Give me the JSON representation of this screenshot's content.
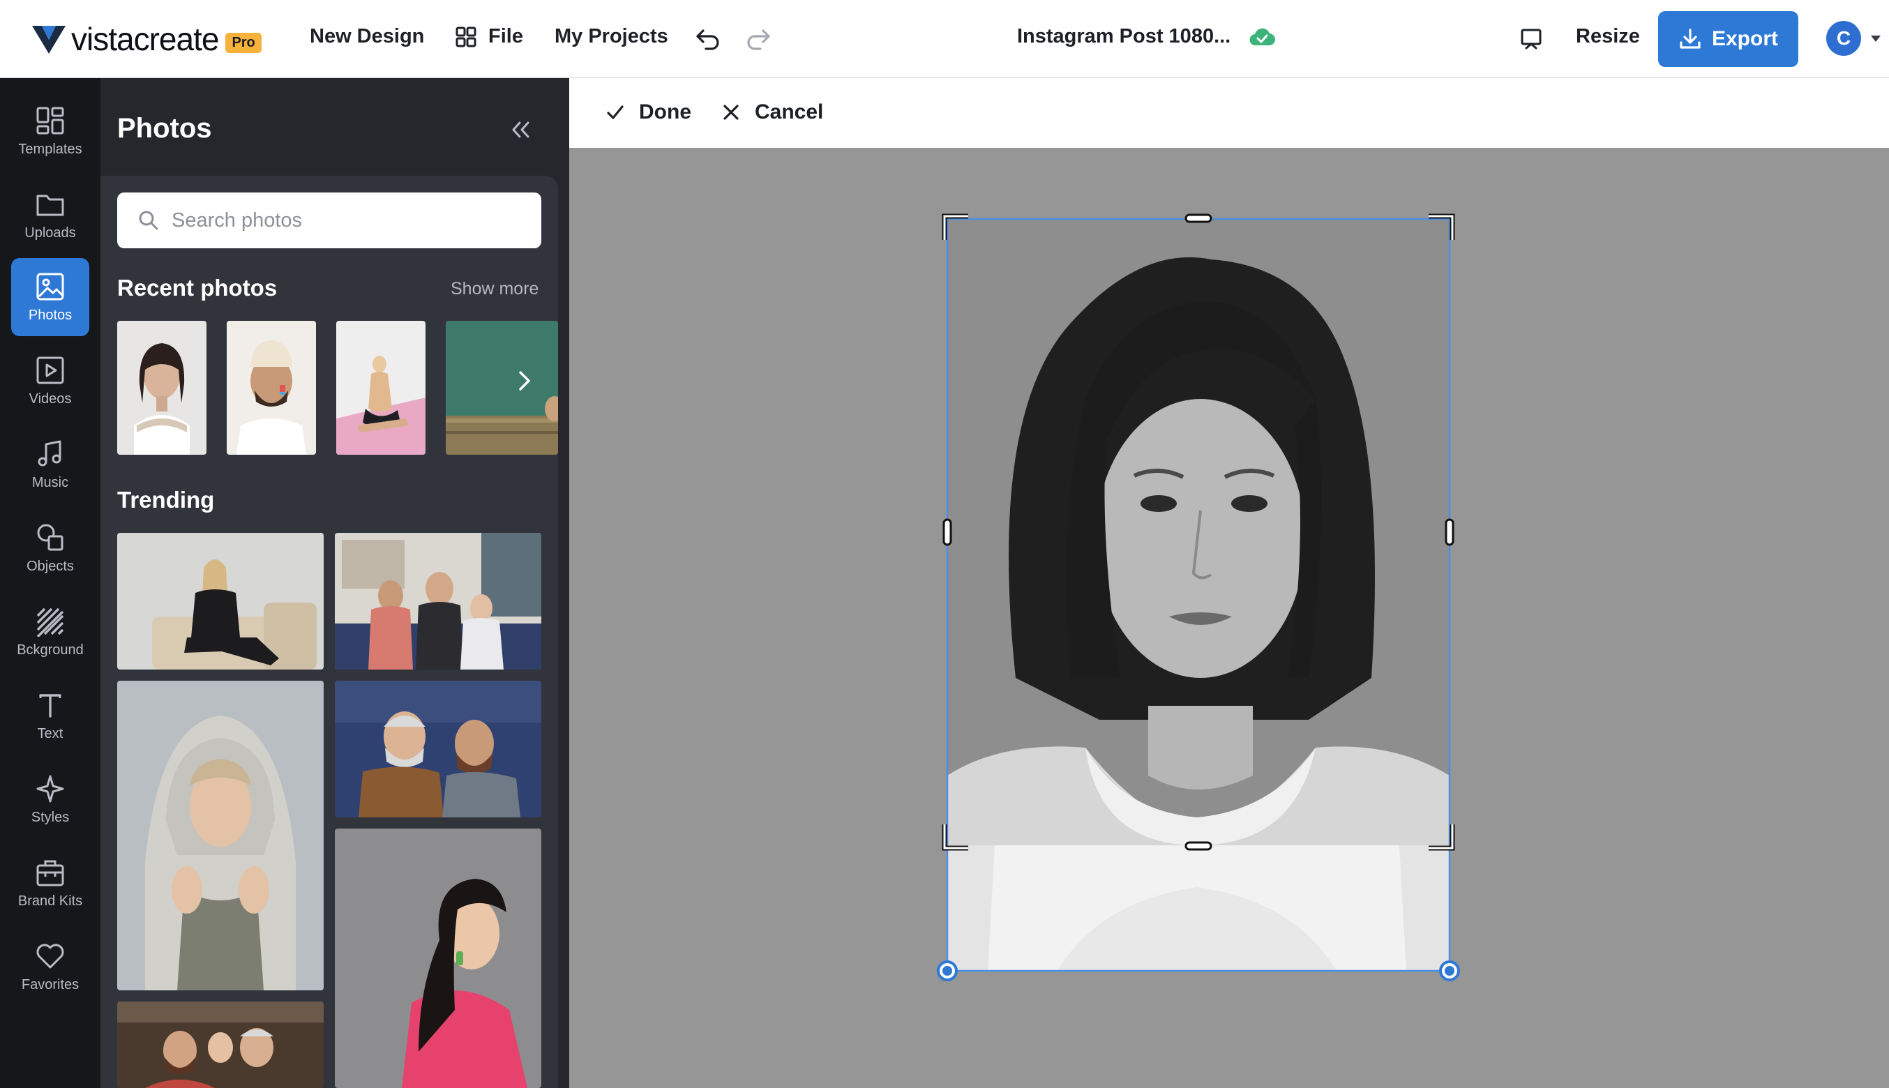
{
  "topbar": {
    "logo_text": "vistacreate",
    "pro_badge": "Pro",
    "new_design": "New Design",
    "file": "File",
    "my_projects": "My Projects",
    "doc_title": "Instagram Post 1080...",
    "resize": "Resize",
    "export": "Export",
    "avatar_initial": "C",
    "colors": {
      "export_bg": "#2f79d6",
      "saved_icon": "#3bb37a",
      "pro_badge": "#f7b23b"
    }
  },
  "rail": {
    "items": [
      {
        "label": "Templates",
        "icon": "templates-icon"
      },
      {
        "label": "Uploads",
        "icon": "folder-icon"
      },
      {
        "label": "Photos",
        "icon": "image-icon",
        "active": true
      },
      {
        "label": "Videos",
        "icon": "play-icon"
      },
      {
        "label": "Music",
        "icon": "music-icon"
      },
      {
        "label": "Objects",
        "icon": "shapes-icon"
      },
      {
        "label": "Bckground",
        "icon": "hatch-icon"
      },
      {
        "label": "Text",
        "icon": "text-icon"
      },
      {
        "label": "Styles",
        "icon": "sparkle-icon"
      },
      {
        "label": "Brand Kits",
        "icon": "briefcase-icon"
      },
      {
        "label": "Favorites",
        "icon": "heart-icon"
      }
    ]
  },
  "panel": {
    "title": "Photos",
    "search": {
      "placeholder": "Search photos",
      "value": ""
    },
    "recent_title": "Recent photos",
    "show_more": "Show more",
    "trending_title": "Trending"
  },
  "crop_bar": {
    "done": "Done",
    "cancel": "Cancel"
  }
}
